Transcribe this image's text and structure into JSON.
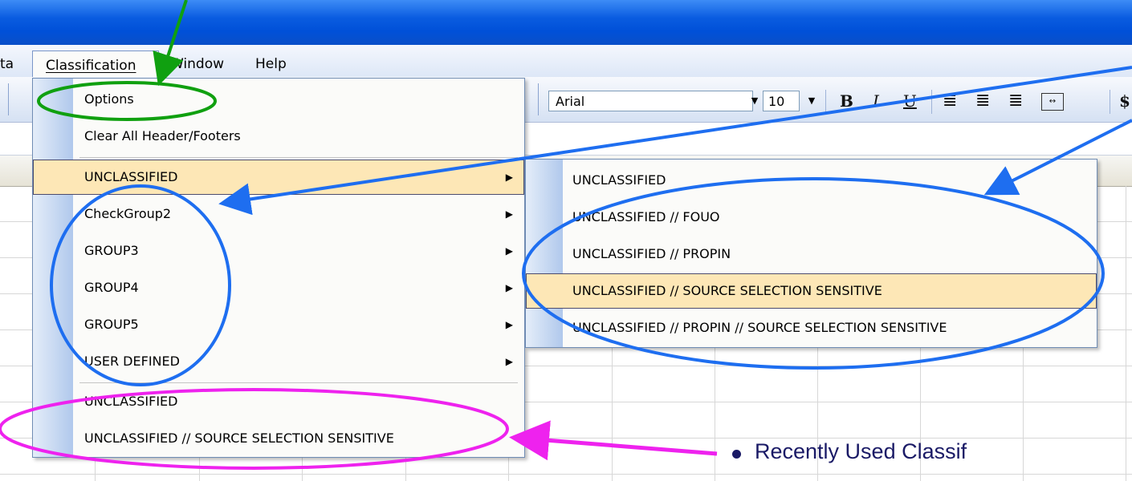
{
  "menubar": {
    "partial_left": "ta",
    "items": [
      {
        "label": "Classification"
      },
      {
        "label": "Window"
      },
      {
        "label": "Help"
      }
    ]
  },
  "toolbar": {
    "font_name": "Arial",
    "font_size": "10",
    "bold": "B",
    "italic": "I",
    "underline": "U",
    "currency": "$"
  },
  "classification_menu": {
    "options": "Options",
    "clear_all": "Clear All Header/Footers",
    "groups": [
      {
        "label": "UNCLASSIFIED",
        "has_submenu": true,
        "highlighted": true
      },
      {
        "label": "CheckGroup2",
        "has_submenu": true
      },
      {
        "label": "GROUP3",
        "has_submenu": true
      },
      {
        "label": "GROUP4",
        "has_submenu": true
      },
      {
        "label": "GROUP5",
        "has_submenu": true
      },
      {
        "label": "USER DEFINED",
        "has_submenu": true
      }
    ],
    "recent": [
      {
        "label": "UNCLASSIFIED"
      },
      {
        "label": "UNCLASSIFIED // SOURCE SELECTION SENSITIVE"
      }
    ]
  },
  "submenu": {
    "items": [
      {
        "label": "UNCLASSIFIED"
      },
      {
        "label": "UNCLASSIFIED // FOUO"
      },
      {
        "label": "UNCLASSIFIED // PROPIN"
      },
      {
        "label": "UNCLASSIFIED // SOURCE SELECTION SENSITIVE",
        "highlighted": true
      },
      {
        "label": "UNCLASSIFIED // PROPIN // SOURCE SELECTION SENSITIVE"
      }
    ]
  },
  "callout": {
    "text": "Recently Used Classif"
  },
  "colors": {
    "titlebar": "#0a5ce0",
    "highlight": "#fde7b6",
    "annotation_green": "#10a010",
    "annotation_blue": "#1e6ef0",
    "annotation_magenta": "#ee22ee"
  }
}
